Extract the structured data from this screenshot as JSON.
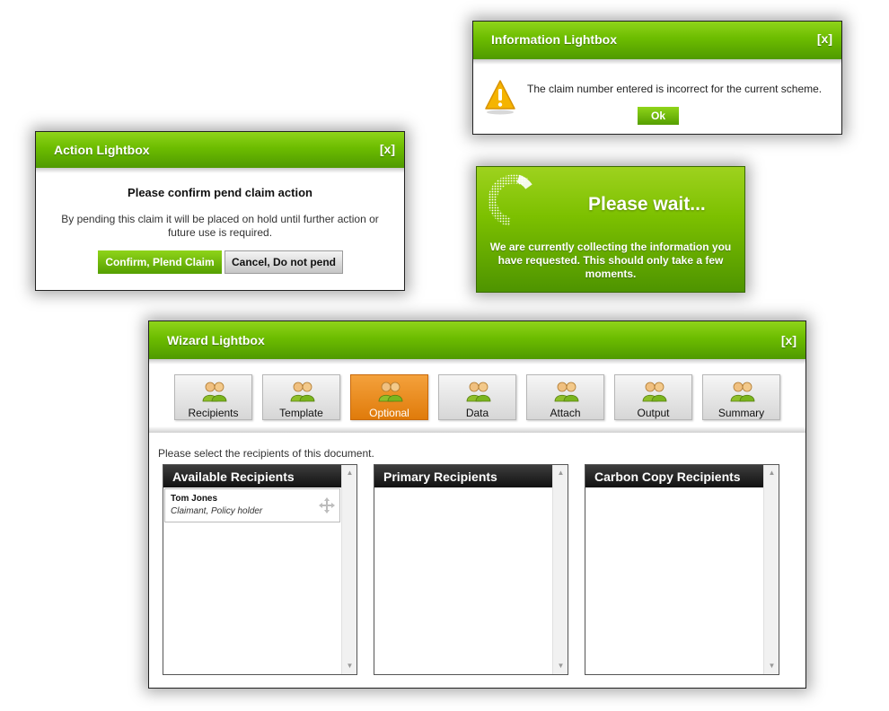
{
  "info_lightbox": {
    "title": "Information Lightbox",
    "close_label": "[x]",
    "message": "The claim number entered is incorrect for the current scheme.",
    "ok_label": "Ok",
    "icon": "warning-icon"
  },
  "action_lightbox": {
    "title": "Action Lightbox",
    "close_label": "[x]",
    "heading": "Please confirm pend claim action",
    "message": "By pending this claim it will be placed on hold until further action or future use is required.",
    "confirm_label": "Confirm, Plend Claim",
    "cancel_label": "Cancel, Do not pend"
  },
  "wait_box": {
    "title": "Please wait...",
    "message": "We are currently collecting the information you have requested. This should only take a few moments.",
    "icon": "loading-spinner-icon"
  },
  "wizard_lightbox": {
    "title": "Wizard Lightbox",
    "close_label": "[x]",
    "steps": [
      {
        "label": "Recipients",
        "active": false
      },
      {
        "label": "Template",
        "active": false
      },
      {
        "label": "Optional",
        "active": true
      },
      {
        "label": "Data",
        "active": false
      },
      {
        "label": "Attach",
        "active": false
      },
      {
        "label": "Output",
        "active": false
      },
      {
        "label": "Summary",
        "active": false
      }
    ],
    "instruction": "Please select the recipients of this document.",
    "lists": [
      {
        "title": "Available Recipients"
      },
      {
        "title": "Primary Recipients"
      },
      {
        "title": "Carbon Copy Recipients"
      }
    ],
    "recipients": [
      {
        "name": "Tom Jones",
        "role": "Claimant, Policy holder"
      }
    ]
  },
  "colors": {
    "accent_green": "#6cbc00",
    "active_step_orange": "#e88a16",
    "list_header_dark": "#1e1e1e"
  }
}
